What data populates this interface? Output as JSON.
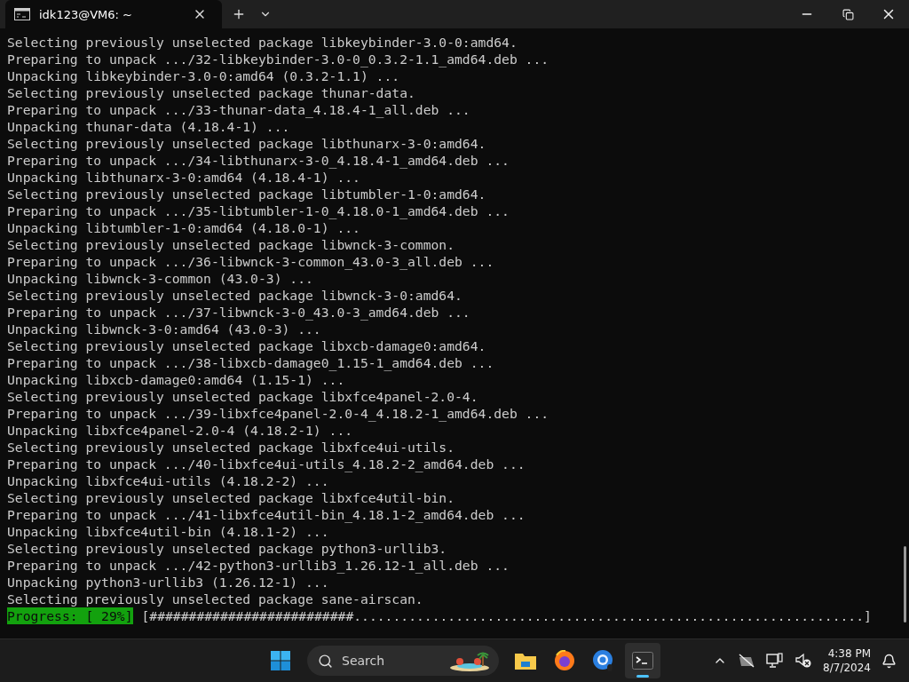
{
  "window": {
    "tab_title": "idk123@VM6: ~"
  },
  "terminal": {
    "lines": [
      "Selecting previously unselected package libkeybinder-3.0-0:amd64.",
      "Preparing to unpack .../32-libkeybinder-3.0-0_0.3.2-1.1_amd64.deb ...",
      "Unpacking libkeybinder-3.0-0:amd64 (0.3.2-1.1) ...",
      "Selecting previously unselected package thunar-data.",
      "Preparing to unpack .../33-thunar-data_4.18.4-1_all.deb ...",
      "Unpacking thunar-data (4.18.4-1) ...",
      "Selecting previously unselected package libthunarx-3-0:amd64.",
      "Preparing to unpack .../34-libthunarx-3-0_4.18.4-1_amd64.deb ...",
      "Unpacking libthunarx-3-0:amd64 (4.18.4-1) ...",
      "Selecting previously unselected package libtumbler-1-0:amd64.",
      "Preparing to unpack .../35-libtumbler-1-0_4.18.0-1_amd64.deb ...",
      "Unpacking libtumbler-1-0:amd64 (4.18.0-1) ...",
      "Selecting previously unselected package libwnck-3-common.",
      "Preparing to unpack .../36-libwnck-3-common_43.0-3_all.deb ...",
      "Unpacking libwnck-3-common (43.0-3) ...",
      "Selecting previously unselected package libwnck-3-0:amd64.",
      "Preparing to unpack .../37-libwnck-3-0_43.0-3_amd64.deb ...",
      "Unpacking libwnck-3-0:amd64 (43.0-3) ...",
      "Selecting previously unselected package libxcb-damage0:amd64.",
      "Preparing to unpack .../38-libxcb-damage0_1.15-1_amd64.deb ...",
      "Unpacking libxcb-damage0:amd64 (1.15-1) ...",
      "Selecting previously unselected package libxfce4panel-2.0-4.",
      "Preparing to unpack .../39-libxfce4panel-2.0-4_4.18.2-1_amd64.deb ...",
      "Unpacking libxfce4panel-2.0-4 (4.18.2-1) ...",
      "Selecting previously unselected package libxfce4ui-utils.",
      "Preparing to unpack .../40-libxfce4ui-utils_4.18.2-2_amd64.deb ...",
      "Unpacking libxfce4ui-utils (4.18.2-2) ...",
      "Selecting previously unselected package libxfce4util-bin.",
      "Preparing to unpack .../41-libxfce4util-bin_4.18.1-2_amd64.deb ...",
      "Unpacking libxfce4util-bin (4.18.1-2) ...",
      "Selecting previously unselected package python3-urllib3.",
      "Preparing to unpack .../42-python3-urllib3_1.26.12-1_all.deb ...",
      "Unpacking python3-urllib3 (1.26.12-1) ...",
      "Selecting previously unselected package sane-airscan."
    ],
    "progress_label": "Progress: [ 29%]",
    "progress_bar": "[##########################.................................................................]"
  },
  "taskbar": {
    "search_placeholder": "Search",
    "time": "4:38 PM",
    "date": "8/7/2024"
  }
}
